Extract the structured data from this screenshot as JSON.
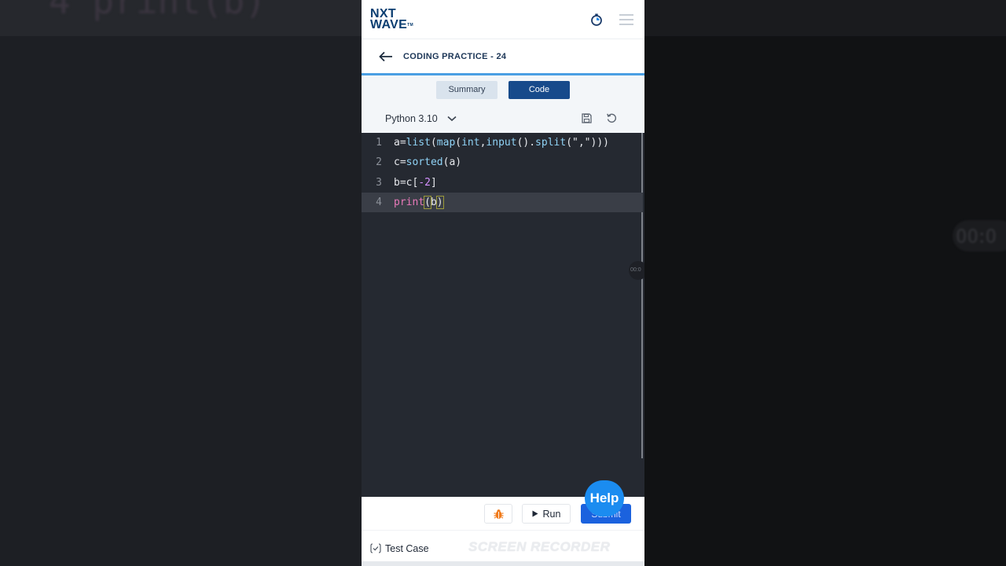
{
  "header": {
    "logo_top": "NXT",
    "logo_bottom": "WAVE",
    "logo_tm": "TM"
  },
  "page": {
    "title": "CODING PRACTICE - 24"
  },
  "tabs": [
    {
      "label": "Summary",
      "selected": false
    },
    {
      "label": "Code",
      "selected": true
    }
  ],
  "editor": {
    "language": "Python 3.10",
    "lines": [
      {
        "num": "1",
        "text": "a=list(map(int,input().split(\",\")))"
      },
      {
        "num": "2",
        "text": "c=sorted(a)"
      },
      {
        "num": "3",
        "text": "b=c[-2]"
      },
      {
        "num": "4",
        "text": "print(b)"
      }
    ],
    "active_line": 4,
    "floating_timer": "00:0"
  },
  "actions": {
    "run_label": "Run",
    "submit_label": "Submit",
    "help_label": "Help"
  },
  "footer": {
    "test_case_label": "Test Case",
    "watermark": "SCREEN RECORDER"
  },
  "background": {
    "ghost_code": "4   print(b)",
    "ghost_timer": "00:0"
  },
  "colors": {
    "brand_dark": "#0b3e71",
    "primary": "#174a8b",
    "submit": "#1b62de",
    "help": "#1b8cf0",
    "editor_bg": "#252931"
  }
}
